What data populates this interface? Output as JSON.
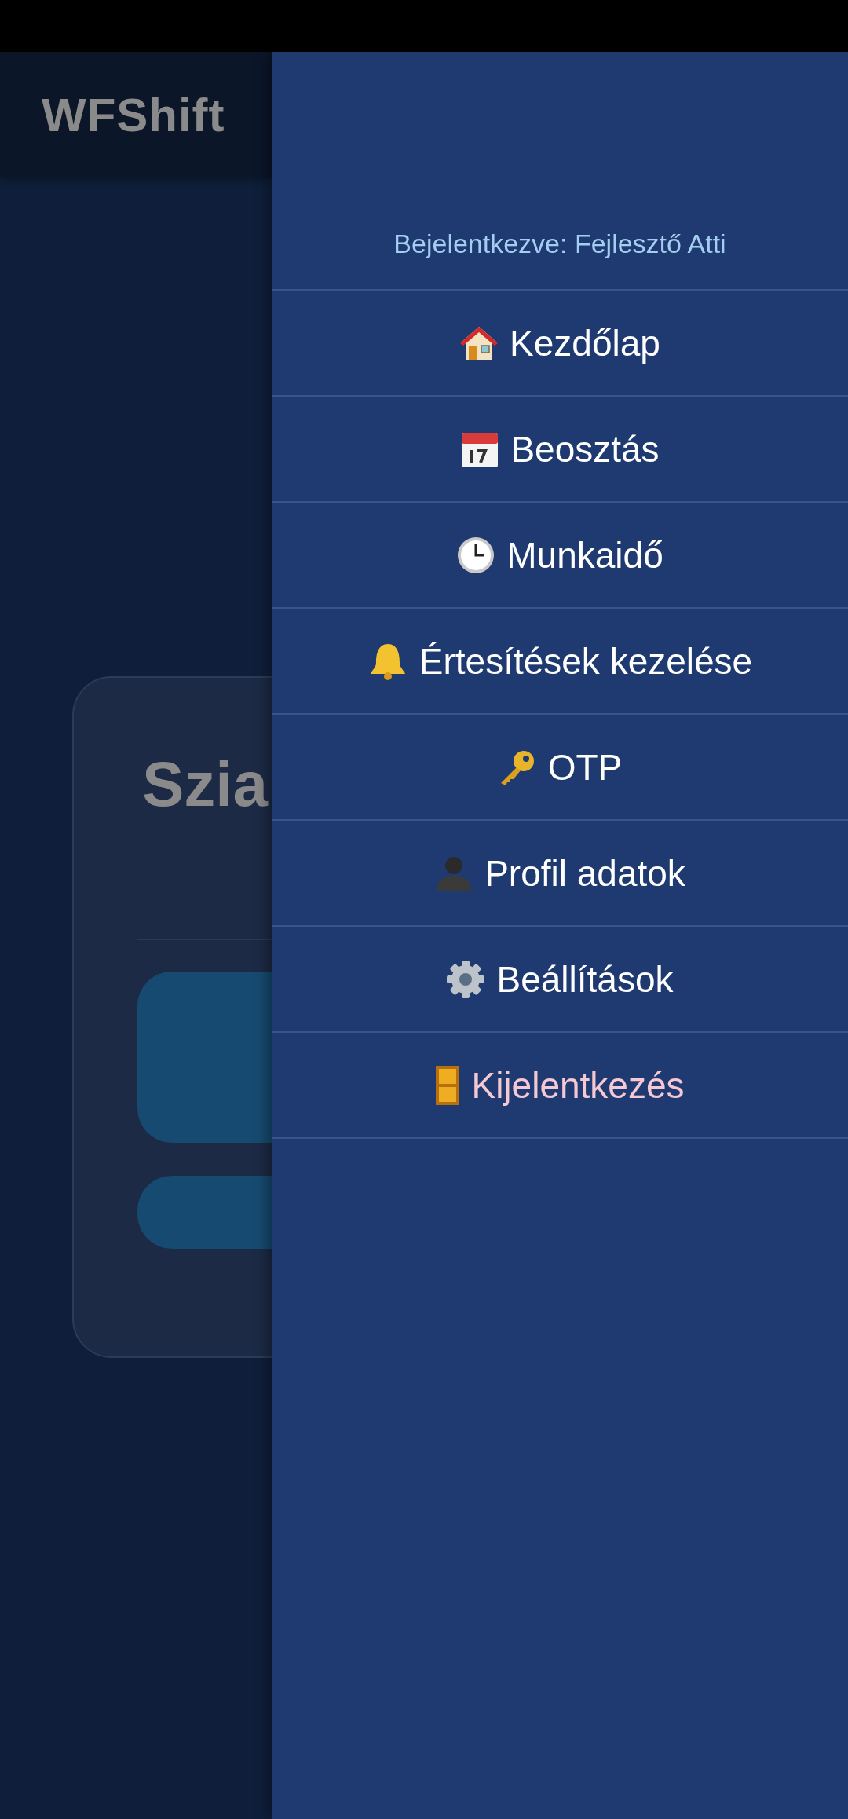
{
  "app_bar": {
    "title": "WFShift"
  },
  "greeting_card": {
    "greeting": "Szia"
  },
  "drawer": {
    "logged_in_as": "Bejelentkezve: Fejlesztő Atti",
    "items": [
      {
        "label": "Kezdőlap",
        "kind": "normal"
      },
      {
        "label": "Beosztás",
        "kind": "normal"
      },
      {
        "label": "Munkaidő",
        "kind": "normal"
      },
      {
        "label": "Értesítések kezelése",
        "kind": "normal"
      },
      {
        "label": "OTP",
        "kind": "normal"
      },
      {
        "label": "Profil adatok",
        "kind": "normal"
      },
      {
        "label": "Beállítások",
        "kind": "normal"
      },
      {
        "label": "Kijelentkezés",
        "kind": "danger"
      }
    ]
  }
}
